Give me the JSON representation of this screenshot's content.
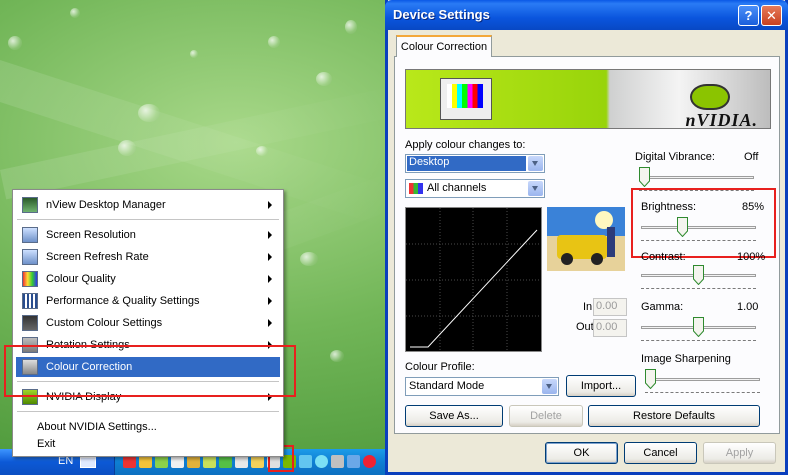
{
  "menu": {
    "items": [
      {
        "label": "nView Desktop Manager",
        "submenu": true
      },
      {
        "label": "Screen Resolution",
        "submenu": true
      },
      {
        "label": "Screen Refresh Rate",
        "submenu": true
      },
      {
        "label": "Colour Quality",
        "submenu": true
      },
      {
        "label": "Performance & Quality Settings",
        "submenu": true
      },
      {
        "label": "Custom Colour Settings",
        "submenu": true
      },
      {
        "label": "Rotation Settings",
        "submenu": true
      },
      {
        "label": "Colour Correction",
        "submenu": false,
        "selected": true
      },
      {
        "label": "NVIDIA Display",
        "submenu": true
      },
      {
        "label": "About NVIDIA Settings...",
        "submenu": false
      },
      {
        "label": "Exit",
        "submenu": false
      }
    ]
  },
  "taskbar": {
    "language": "EN"
  },
  "dialog": {
    "title": "Device Settings",
    "help_label": "?",
    "close_label": "✕",
    "tab_label": "Colour Correction",
    "brand_text": "nVIDIA.",
    "apply_to_label": "Apply colour changes to:",
    "apply_to_value": "Desktop",
    "channels_value": "All channels",
    "in_label": "In",
    "in_value": "0.00",
    "out_label": "Out",
    "out_value": "0.00",
    "profile_label": "Colour Profile:",
    "profile_value": "Standard Mode",
    "import_button": "Import...",
    "save_as_button": "Save As...",
    "delete_button": "Delete",
    "restore_button": "Restore Defaults",
    "ok_button": "OK",
    "cancel_button": "Cancel",
    "apply_button": "Apply",
    "sliders": {
      "vibrance": {
        "label": "Digital Vibrance:",
        "value": "Off",
        "level": 0.0
      },
      "brightness": {
        "label": "Brightness:",
        "value": "85%",
        "level": 0.35
      },
      "contrast": {
        "label": "Contrast:",
        "value": "100%",
        "level": 0.5
      },
      "gamma": {
        "label": "Gamma:",
        "value": "1.00",
        "level": 0.5
      },
      "sharpening": {
        "label": "Image Sharpening",
        "value": "",
        "level": 0.0
      }
    }
  },
  "colors": {
    "accent": "#316ac5",
    "highlight_box": "#e8201e",
    "title_bar": "#0a55dd"
  }
}
